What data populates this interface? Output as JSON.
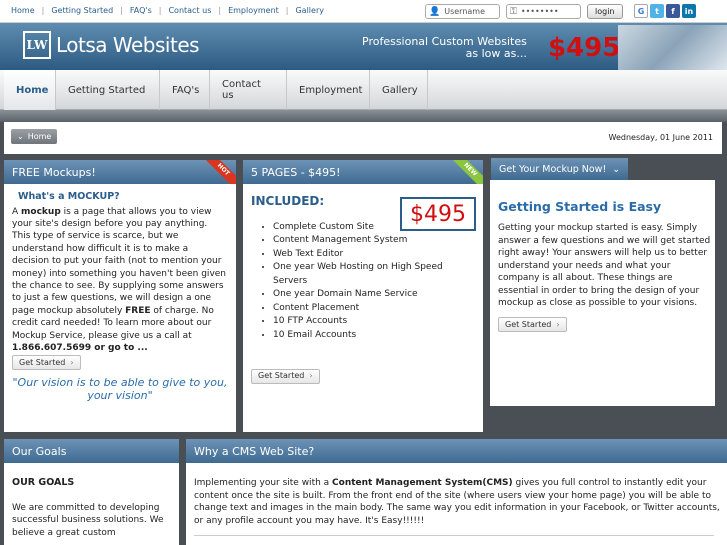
{
  "toplinks": [
    "Home",
    "Getting Started",
    "FAQ's",
    "Contact us",
    "Employment",
    "Gallery"
  ],
  "login": {
    "username_placeholder": "Username",
    "password_placeholder": "••••••••",
    "button": "login"
  },
  "social": [
    "G",
    "t",
    "f",
    "in"
  ],
  "header": {
    "logo_mark": "LW",
    "logo_text": "Lotsa Websites",
    "promo_line1": "Professional Custom Websites",
    "promo_line2": "as low as...",
    "promo_price": "$495"
  },
  "nav": [
    "Home",
    "Getting Started",
    "FAQ's",
    "Contact us",
    "Employment",
    "Gallery"
  ],
  "breadcrumb": "Home",
  "date": "Wednesday, 01 June 2011",
  "mockups": {
    "title": "FREE Mockups!",
    "ribbon": "HOT",
    "heading": "What's a MOCKUP?",
    "text_a": "A ",
    "text_b": "mockup",
    "text_c": " is a page that allows you to view your site's design before you pay anything. This type of service is scarce, but we understand how difficult it is to make a decision to put your faith (not to mention your money) into something you haven't been given the chance to see. By supplying some answers to just a few questions, we will design a one page mockup absolutely ",
    "text_d": "FREE",
    "text_e": " of charge. No credit card needed! To learn more about our Mockup Service, please give us a call at ",
    "text_f": "1.866.607.5699 or go to ...",
    "button": "Get Started",
    "vision": "\"Our vision is to be able to give to you, your vision\""
  },
  "pages": {
    "title": "5 PAGES - $495!",
    "ribbon": "NEW",
    "included": "INCLUDED:",
    "price": "$495",
    "features": [
      "Complete Custom Site",
      "Content Management System",
      "Web Text Editor",
      "One year Web Hosting on High Speed Servers",
      "One year Domain Name Service",
      "Content Placement",
      "10 FTP Accounts",
      "10 Email Accounts"
    ],
    "button": "Get Started"
  },
  "getmockup": {
    "tab": "Get Your Mockup Now!",
    "heading": "Getting Started is Easy",
    "text": "Getting your mockup started is easy. Simply answer a few questions and we will get started right away! Your answers will help us to better understand your needs and what your company is all about. These things are essential in order to bring the design of your mockup as close as possible to your visions.",
    "button": "Get Started"
  },
  "goals": {
    "title": "Our Goals",
    "heading": "OUR GOALS",
    "text": "We are committed to developing successful business solutions. We believe a great custom"
  },
  "cms": {
    "title": "Why a CMS Web Site?",
    "text_a": "Implementing your site with a ",
    "text_b": "Content Management System(CMS)",
    "text_c": " gives you full control to instantly edit your content once the site is built. From the front end of the site (where users view your home page) you will be able to change text and images in the main body. The same way you edit information in your Facebook, or Twitter accounts, or any profile account you may have. It's Easy!!!!!!"
  },
  "colors": {
    "accent": "#2a5d8a",
    "price": "#d01010",
    "hot": "#d8361f",
    "new": "#8cc63f"
  }
}
